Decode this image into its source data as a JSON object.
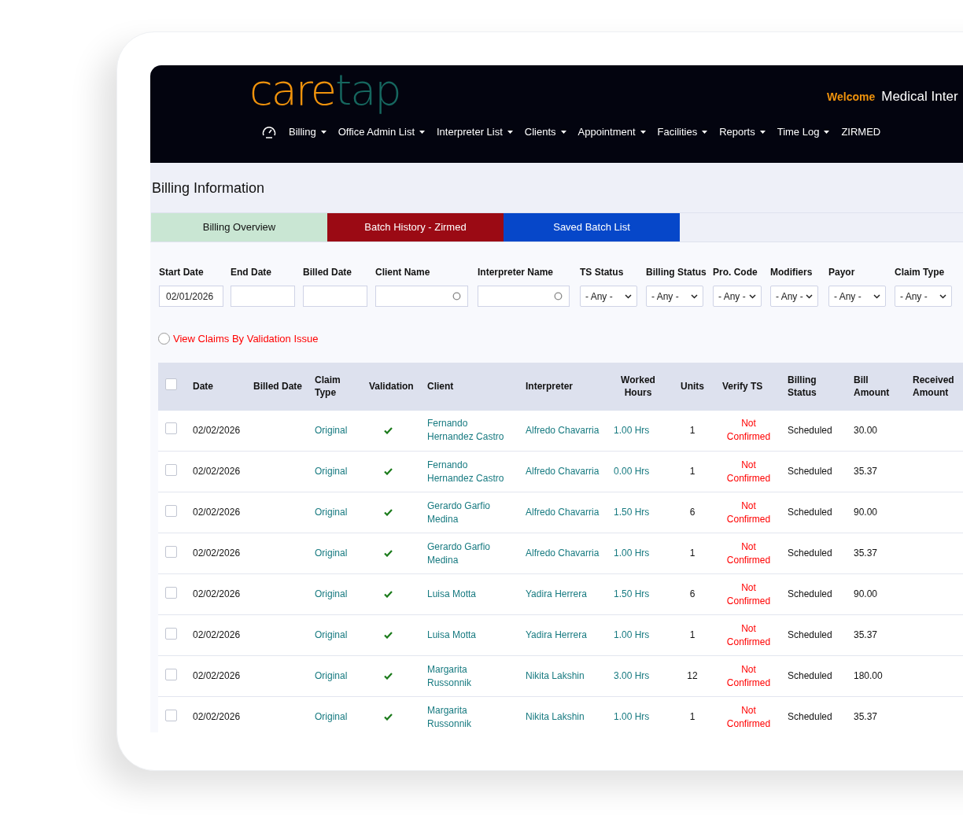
{
  "header": {
    "logo": {
      "part_1": "care",
      "part_2": "tap"
    },
    "welcome": "Welcome",
    "user": "Medical Inter"
  },
  "nav": [
    {
      "label": "Billing",
      "dropdown": true
    },
    {
      "label": "Office Admin List",
      "dropdown": true
    },
    {
      "label": "Interpreter List",
      "dropdown": true
    },
    {
      "label": "Clients",
      "dropdown": true
    },
    {
      "label": "Appointment",
      "dropdown": true
    },
    {
      "label": "Facilities",
      "dropdown": true
    },
    {
      "label": "Reports",
      "dropdown": true
    },
    {
      "label": "Time Log",
      "dropdown": true
    },
    {
      "label": "ZIRMED",
      "dropdown": false
    }
  ],
  "page_title": "Billing Information",
  "tabs": [
    {
      "label": "Billing Overview",
      "color": "#c9e6d3"
    },
    {
      "label": "Batch History - Zirmed",
      "color": "#9b0a14"
    },
    {
      "label": "Saved Batch List",
      "color": "#0647c9"
    }
  ],
  "filters": [
    {
      "label": "Start Date",
      "kind": "text",
      "value": "02/01/2026"
    },
    {
      "label": "End Date",
      "kind": "text"
    },
    {
      "label": "Billed Date",
      "kind": "text"
    },
    {
      "label": "Client Name",
      "kind": "search"
    },
    {
      "label": "Interpreter Name",
      "kind": "search"
    },
    {
      "label": "TS Status",
      "kind": "select",
      "value": "- Any -"
    },
    {
      "label": "Billing Status",
      "kind": "select",
      "value": "- Any -"
    },
    {
      "label": "Pro. Code",
      "kind": "select",
      "value": "- Any -"
    },
    {
      "label": "Modifiers",
      "kind": "select",
      "value": "- Any -"
    },
    {
      "label": "Payor",
      "kind": "select",
      "value": "- Any -"
    },
    {
      "label": "Claim Type",
      "kind": "select",
      "value": "- Any -"
    }
  ],
  "validation_filter": {
    "label": "View Claims By Validation Issue",
    "selected": false
  },
  "table": {
    "select_all": {
      "checked": false
    },
    "columns": [
      "Date",
      "Billed Date",
      "Claim Type",
      "Validation",
      "Client",
      "Interpreter",
      "Worked Hours",
      "Units",
      "Verify TS",
      "Billing Status",
      "Bill Amount",
      "Received Amount"
    ],
    "rows": [
      {
        "checked": false,
        "date": "02/02/2026",
        "claim_type": "Original",
        "valid": true,
        "client": "Fernando Hernandez Castro",
        "interpreter": "Alfredo Chavarria",
        "worked_hours": "1.00 Hrs",
        "units": "1",
        "verify_ts": "Not Confirmed",
        "billing_status": "Scheduled",
        "bill_amount": "30.00"
      },
      {
        "checked": false,
        "date": "02/02/2026",
        "claim_type": "Original",
        "valid": true,
        "client": "Fernando Hernandez Castro",
        "interpreter": "Alfredo Chavarria",
        "worked_hours": "0.00 Hrs",
        "units": "1",
        "verify_ts": "Not Confirmed",
        "billing_status": "Scheduled",
        "bill_amount": "35.37"
      },
      {
        "checked": false,
        "date": "02/02/2026",
        "claim_type": "Original",
        "valid": true,
        "client": "Gerardo Garfio Medina",
        "interpreter": "Alfredo Chavarria",
        "worked_hours": "1.50 Hrs",
        "units": "6",
        "verify_ts": "Not Confirmed",
        "billing_status": "Scheduled",
        "bill_amount": "90.00"
      },
      {
        "checked": false,
        "date": "02/02/2026",
        "claim_type": "Original",
        "valid": true,
        "client": "Gerardo Garfio Medina",
        "interpreter": "Alfredo Chavarria",
        "worked_hours": "1.00 Hrs",
        "units": "1",
        "verify_ts": "Not Confirmed",
        "billing_status": "Scheduled",
        "bill_amount": "35.37"
      },
      {
        "checked": false,
        "date": "02/02/2026",
        "claim_type": "Original",
        "valid": true,
        "client": "Luisa Motta",
        "interpreter": "Yadira Herrera",
        "worked_hours": "1.50 Hrs",
        "units": "6",
        "verify_ts": "Not Confirmed",
        "billing_status": "Scheduled",
        "bill_amount": "90.00"
      },
      {
        "checked": false,
        "date": "02/02/2026",
        "claim_type": "Original",
        "valid": true,
        "client": "Luisa Motta",
        "interpreter": "Yadira Herrera",
        "worked_hours": "1.00 Hrs",
        "units": "1",
        "verify_ts": "Not Confirmed",
        "billing_status": "Scheduled",
        "bill_amount": "35.37"
      },
      {
        "checked": false,
        "date": "02/02/2026",
        "claim_type": "Original",
        "valid": true,
        "client": "Margarita Russonnik",
        "interpreter": "Nikita Lakshin",
        "worked_hours": "3.00 Hrs",
        "units": "12",
        "verify_ts": "Not Confirmed",
        "billing_status": "Scheduled",
        "bill_amount": "180.00"
      },
      {
        "checked": false,
        "date": "02/02/2026",
        "claim_type": "Original",
        "valid": true,
        "client": "Margarita Russonnik",
        "interpreter": "Nikita Lakshin",
        "worked_hours": "1.00 Hrs",
        "units": "1",
        "verify_ts": "Not Confirmed",
        "billing_status": "Scheduled",
        "bill_amount": "35.37"
      }
    ]
  }
}
